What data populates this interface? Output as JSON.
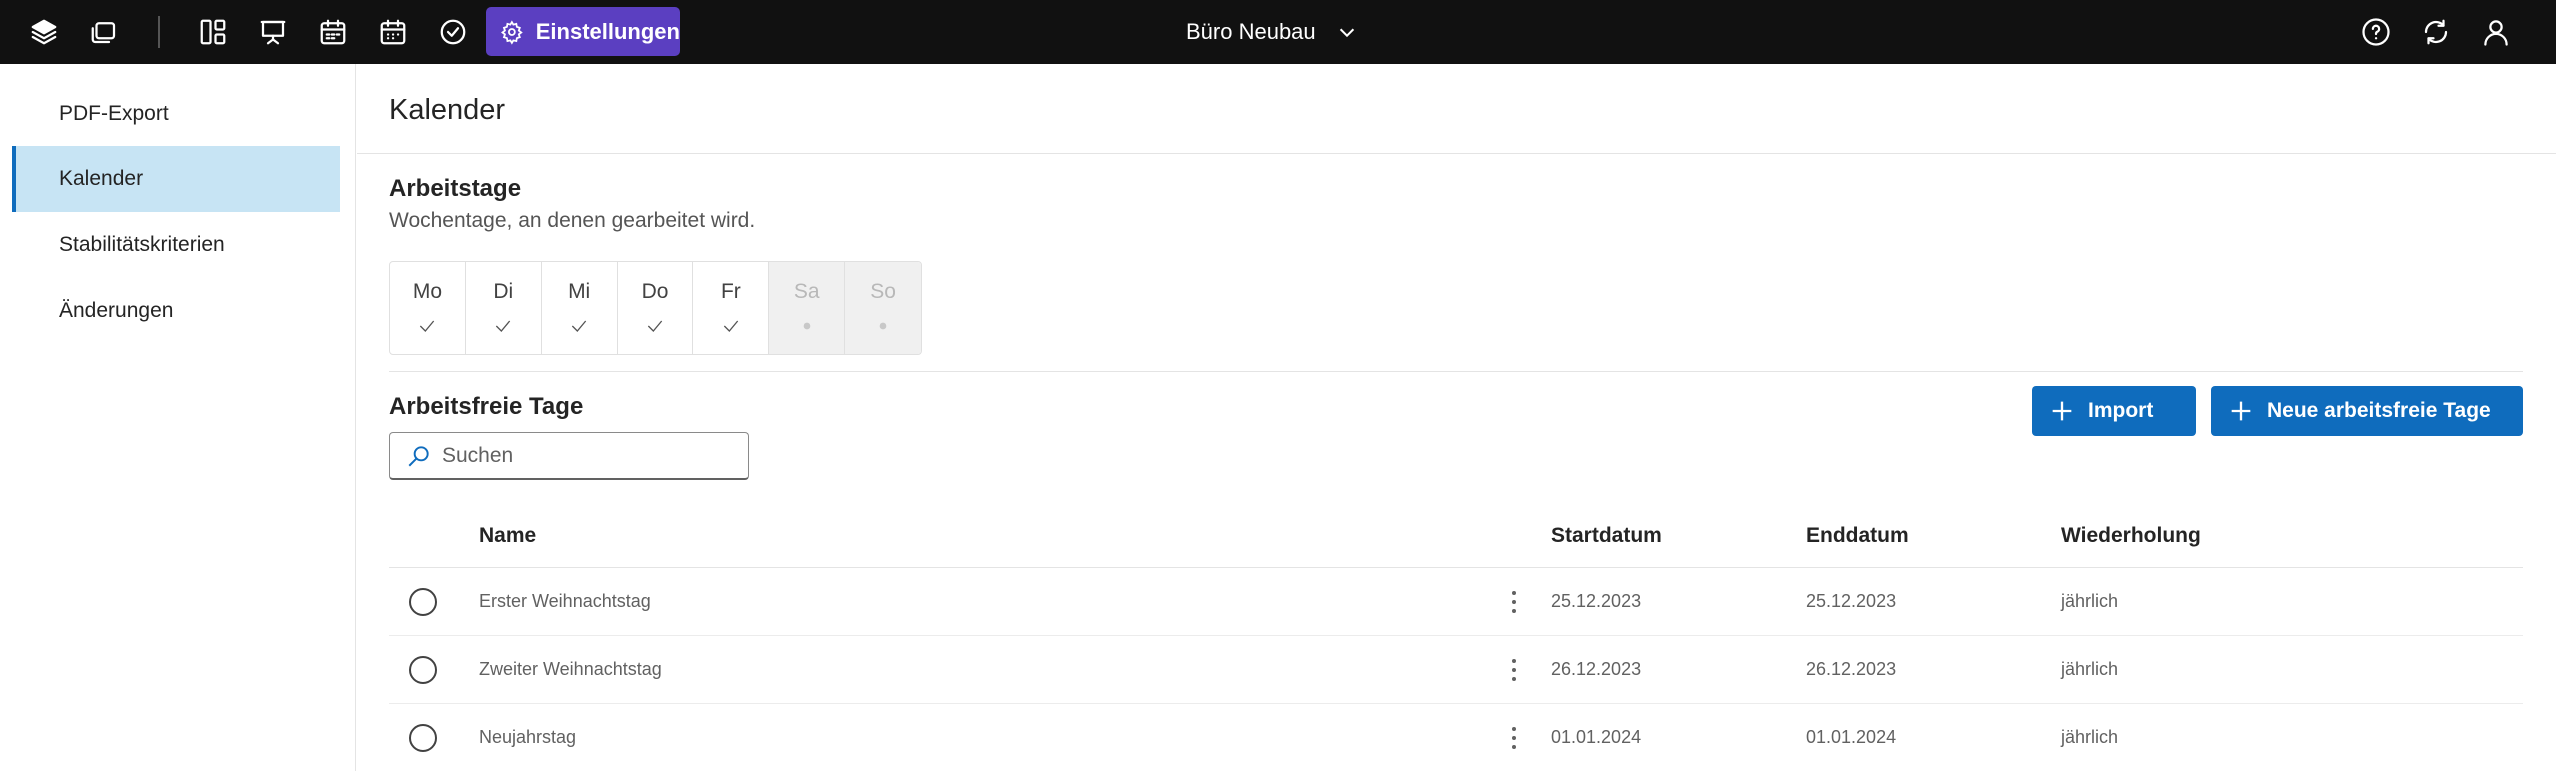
{
  "topbar": {
    "icons": [
      "layers-icon",
      "stack-icon",
      "dashboard-icon",
      "presentation-icon",
      "calendar-schedule-icon",
      "calendar-icon",
      "check-circle-icon"
    ],
    "settings_label": "Einstellungen",
    "project_name": "Büro Neubau",
    "right_icons": [
      "help-icon",
      "sync-icon",
      "user-icon"
    ],
    "accent_color": "#5b3fc1"
  },
  "sidebar": {
    "items": [
      {
        "label": "PDF-Export",
        "active": false
      },
      {
        "label": "Kalender",
        "active": true
      },
      {
        "label": "Stabilitätskriterien",
        "active": false
      },
      {
        "label": "Änderungen",
        "active": false
      }
    ]
  },
  "page": {
    "title": "Kalender"
  },
  "workdays": {
    "title": "Arbeitstage",
    "subtitle": "Wochentage, an denen gearbeitet wird.",
    "days": [
      {
        "label": "Mo",
        "working": true
      },
      {
        "label": "Di",
        "working": true
      },
      {
        "label": "Mi",
        "working": true
      },
      {
        "label": "Do",
        "working": true
      },
      {
        "label": "Fr",
        "working": true
      },
      {
        "label": "Sa",
        "working": false
      },
      {
        "label": "So",
        "working": false
      }
    ]
  },
  "holidays": {
    "title": "Arbeitsfreie Tage",
    "import_label": "Import",
    "new_label": "Neue arbeitsfreie Tage",
    "search_placeholder": "Suchen",
    "columns": {
      "name": "Name",
      "start": "Startdatum",
      "end": "Enddatum",
      "repeat": "Wiederholung"
    },
    "rows": [
      {
        "name": "Erster Weihnachtstag",
        "start": "25.12.2023",
        "end": "25.12.2023",
        "repeat": "jährlich"
      },
      {
        "name": "Zweiter Weihnachtstag",
        "start": "26.12.2023",
        "end": "26.12.2023",
        "repeat": "jährlich"
      },
      {
        "name": "Neujahrstag",
        "start": "01.01.2024",
        "end": "01.01.2024",
        "repeat": "jährlich"
      }
    ]
  }
}
